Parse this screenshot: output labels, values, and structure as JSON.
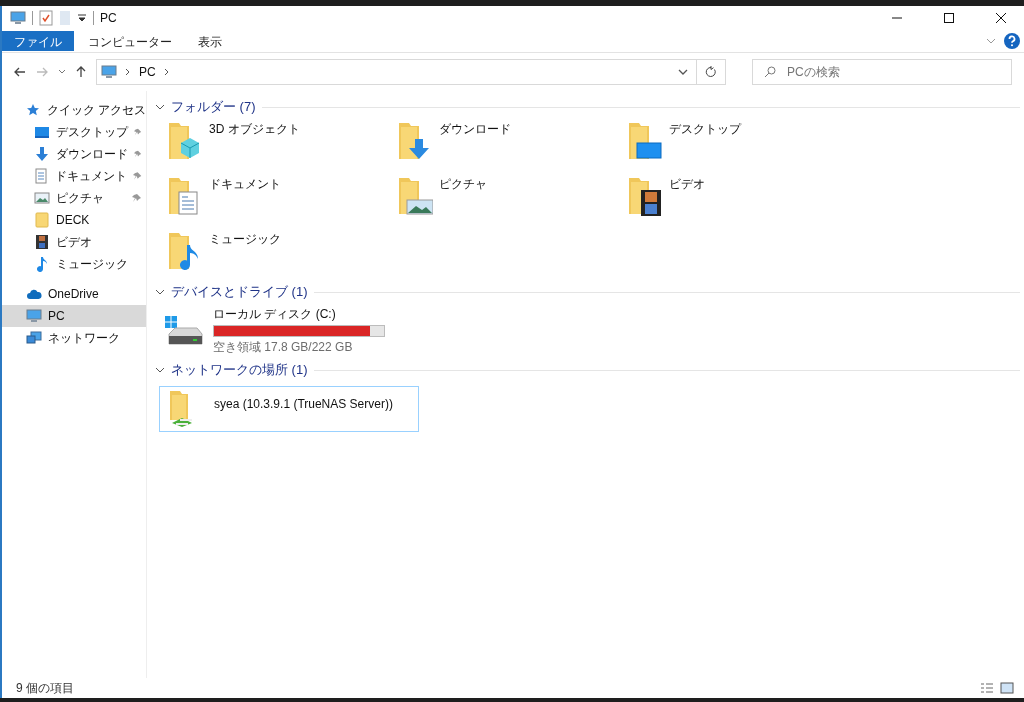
{
  "window": {
    "title": "PC"
  },
  "ribbon_tabs": [
    {
      "label": "ファイル",
      "selected": true
    },
    {
      "label": "コンピューター",
      "selected": false
    },
    {
      "label": "表示",
      "selected": false
    }
  ],
  "address": {
    "crumbs": [
      "PC"
    ]
  },
  "search": {
    "placeholder": "PCの検索"
  },
  "sidebar": {
    "items": [
      {
        "label": "クイック アクセス",
        "kind": "quick-access",
        "selected": false,
        "children": [
          {
            "label": "デスクトップ",
            "kind": "desktop",
            "pinned": true,
            "selected": false
          },
          {
            "label": "ダウンロード",
            "kind": "download",
            "pinned": true,
            "selected": false
          },
          {
            "label": "ドキュメント",
            "kind": "documents",
            "pinned": true,
            "selected": false
          },
          {
            "label": "ピクチャ",
            "kind": "pictures",
            "pinned": true,
            "selected": false
          },
          {
            "label": "DECK",
            "kind": "folder",
            "pinned": false,
            "selected": false
          },
          {
            "label": "ビデオ",
            "kind": "videos",
            "pinned": false,
            "selected": false
          },
          {
            "label": "ミュージック",
            "kind": "music",
            "pinned": false,
            "selected": false
          }
        ]
      },
      {
        "label": "OneDrive",
        "kind": "cloud",
        "selected": false
      },
      {
        "label": "PC",
        "kind": "pc",
        "selected": true
      },
      {
        "label": "ネットワーク",
        "kind": "network",
        "selected": false
      }
    ]
  },
  "sections": [
    {
      "title": "フォルダー (7)",
      "kind": "folders",
      "items": [
        {
          "label": "3D オブジェクト",
          "kind": "objects"
        },
        {
          "label": "ダウンロード",
          "kind": "download"
        },
        {
          "label": "デスクトップ",
          "kind": "desktop"
        },
        {
          "label": "ドキュメント",
          "kind": "documents"
        },
        {
          "label": "ピクチャ",
          "kind": "pictures"
        },
        {
          "label": "ビデオ",
          "kind": "videos"
        },
        {
          "label": "ミュージック",
          "kind": "music"
        }
      ]
    },
    {
      "title": "デバイスとドライブ (1)",
      "kind": "drives",
      "items": [
        {
          "label": "ローカル ディスク (C:)",
          "level": 0.92,
          "free": "空き領域 17.8 GB/222 GB"
        }
      ]
    },
    {
      "title": "ネットワークの場所 (1)",
      "kind": "network",
      "items": [
        {
          "label": "syea (10.3.9.1 (TrueNAS Server))",
          "focused": true
        }
      ]
    }
  ],
  "status_bar": {
    "text": "9 個の項目"
  }
}
